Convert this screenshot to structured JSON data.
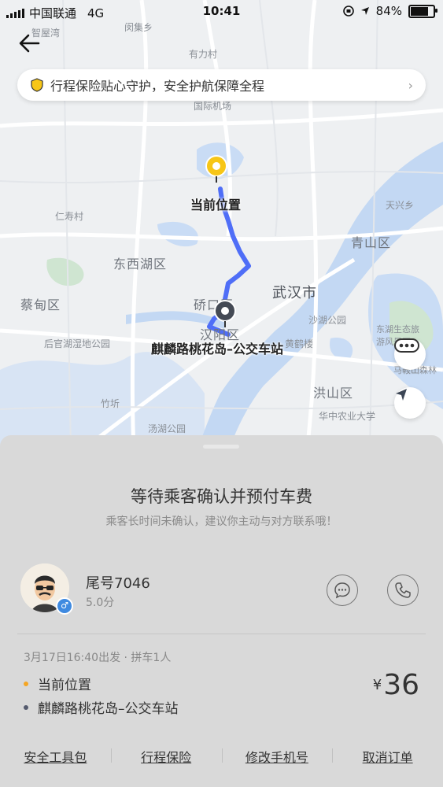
{
  "status_bar": {
    "carrier": "中国联通",
    "network": "4G",
    "time": "10:41",
    "battery": "84%",
    "battery_level": 0.84
  },
  "banner": {
    "text": "行程保险贴心守护，安全护航保障全程"
  },
  "map": {
    "labels": [
      "智屋湾",
      "闵集乡",
      "有力村",
      "国际机场",
      "仁寿村",
      "东西湖区",
      "蔡甸区",
      "硚口区",
      "汉阳区",
      "武汉市",
      "沙湖公园",
      "黄鹤楼",
      "后官湖湿地公园",
      "竹圻",
      "汤湖公园",
      "洪山区",
      "华中农业大学",
      "青山区",
      "天兴乡",
      "东湖生态旅游风景区",
      "马鞍山森林"
    ],
    "start_label": "当前位置",
    "end_label": "麒麟路桃花岛–公交车站"
  },
  "sheet": {
    "title": "等待乘客确认并预付车费",
    "subtitle": "乘客长时间未确认，建议你主动与对方联系哦！",
    "passenger": {
      "name": "尾号7046",
      "rating": "5.0分",
      "gender": "♂"
    },
    "trip": {
      "meta": "3月17日16:40出发 · 拼车1人",
      "from": "当前位置",
      "to": "麒麟路桃花岛–公交车站",
      "currency": "¥",
      "price": "36",
      "from_color": "#f5a623",
      "to_color": "#555b6e"
    },
    "footer": [
      "安全工具包",
      "行程保险",
      "修改手机号",
      "取消订单"
    ]
  },
  "colors": {
    "route": "#4f6ef7",
    "start_pin": "#f7c617"
  }
}
